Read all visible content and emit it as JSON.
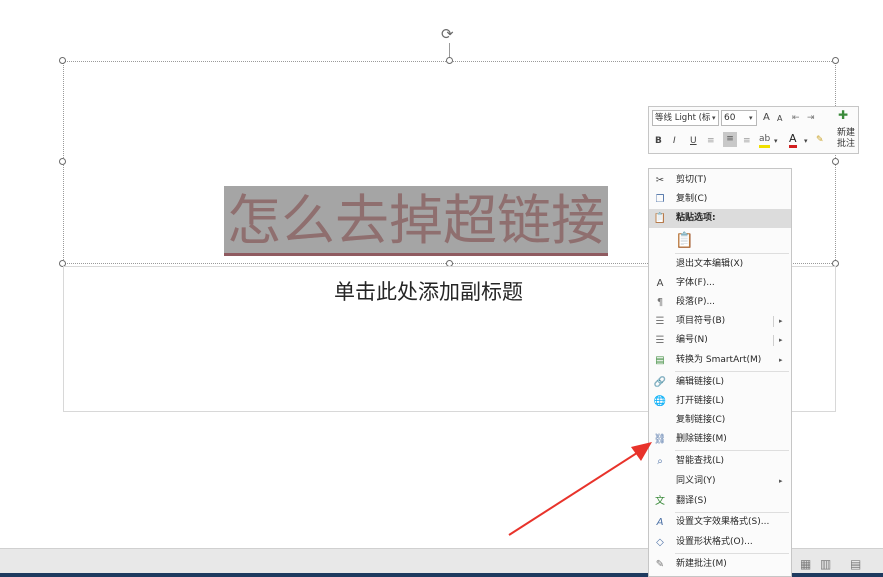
{
  "slide": {
    "title": "怎么去掉超链接",
    "subtitle": "单击此处添加副标题"
  },
  "mini_toolbar": {
    "font_name": "等线 Light (标",
    "font_dropdown_arrow": "▾",
    "font_size": "60",
    "size_dropdown_arrow": "▾",
    "grow_font": "A",
    "shrink_font": "A",
    "bold": "B",
    "italic": "I",
    "underline": "U",
    "highlight_arrow": "▾",
    "font_color": "A",
    "font_color_arrow": "▾",
    "new_comment": "新建\n批注"
  },
  "context_menu": {
    "items": [
      {
        "label": "剪切(T)",
        "icon": "scissors-icon",
        "glyph": "✂"
      },
      {
        "label": "复制(C)",
        "icon": "copy-icon",
        "glyph": "❐"
      },
      {
        "label": "粘贴选项:",
        "icon": "paste-icon",
        "glyph": "📋"
      },
      {
        "label": "退出文本编辑(X)",
        "icon": "",
        "glyph": ""
      },
      {
        "label": "字体(F)...",
        "icon": "font-icon",
        "glyph": "A"
      },
      {
        "label": "段落(P)...",
        "icon": "paragraph-icon",
        "glyph": "¶"
      },
      {
        "label": "项目符号(B)",
        "icon": "bullets-icon",
        "glyph": "☰"
      },
      {
        "label": "编号(N)",
        "icon": "numbering-icon",
        "glyph": "☰"
      },
      {
        "label": "转换为 SmartArt(M)",
        "icon": "smartart-icon",
        "glyph": "▤"
      },
      {
        "label": "编辑链接(L)",
        "icon": "edit-link-icon",
        "glyph": "🔗"
      },
      {
        "label": "打开链接(L)",
        "icon": "open-link-icon",
        "glyph": "🌐"
      },
      {
        "label": "复制链接(C)",
        "icon": "",
        "glyph": ""
      },
      {
        "label": "删除链接(M)",
        "icon": "remove-link-icon",
        "glyph": "⛓"
      },
      {
        "label": "智能查找(L)",
        "icon": "smart-lookup-icon",
        "glyph": "⌕"
      },
      {
        "label": "同义词(Y)",
        "icon": "",
        "glyph": ""
      },
      {
        "label": "翻译(S)",
        "icon": "translate-icon",
        "glyph": "文"
      },
      {
        "label": "设置文字效果格式(S)...",
        "icon": "text-effect-icon",
        "glyph": "A"
      },
      {
        "label": "设置形状格式(O)...",
        "icon": "shape-format-icon",
        "glyph": "◇"
      },
      {
        "label": "新建批注(M)",
        "icon": "new-comment-icon",
        "glyph": "✎"
      }
    ],
    "submenu_arrow": "▸",
    "paste_option_glyph": "📋"
  },
  "status_bar": {
    "normal_view_icon": "▦",
    "slide_sorter_icon": "▥",
    "reading_view_icon": "▤"
  },
  "rotate_glyph": "⟳",
  "colors": {
    "title_selection_bg": "#a5a5a5",
    "title_text": "#8f6f6f",
    "arrow": "#e8332b",
    "menu_highlight": "#dcdcdc"
  }
}
